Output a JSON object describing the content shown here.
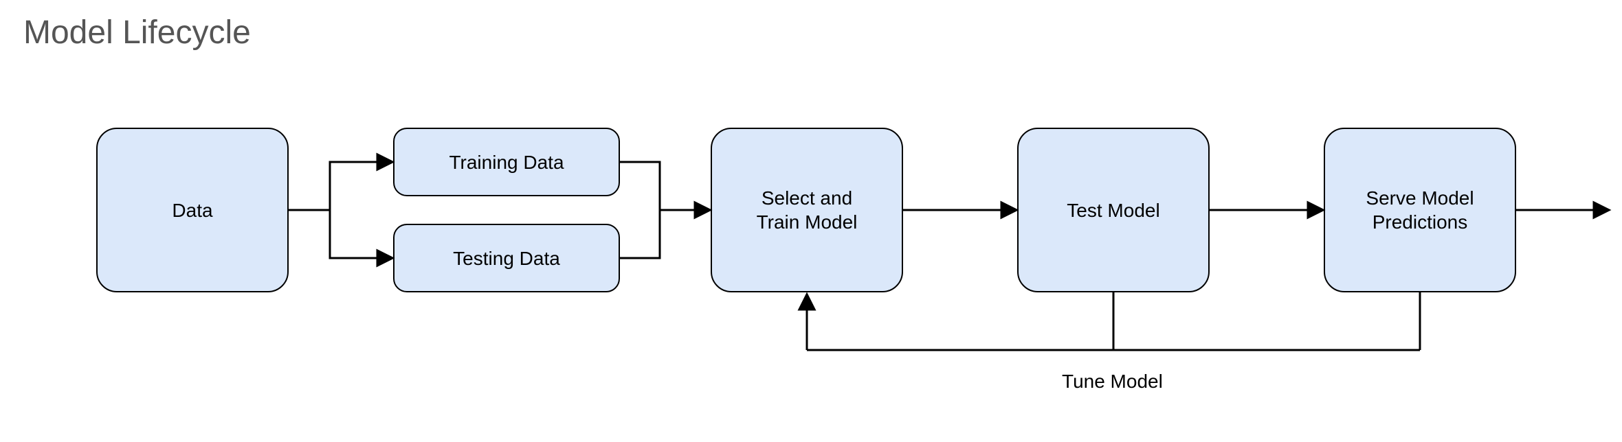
{
  "title": "Model Lifecycle",
  "nodes": {
    "data": "Data",
    "training_data": "Training Data",
    "testing_data": "Testing Data",
    "select_train": "Select and\nTrain Model",
    "test_model": "Test Model",
    "serve": "Serve Model\nPredictions"
  },
  "feedback_label": "Tune Model",
  "colors": {
    "node_fill": "#dbe8fa",
    "node_border": "#000000",
    "title_color": "#555555"
  }
}
